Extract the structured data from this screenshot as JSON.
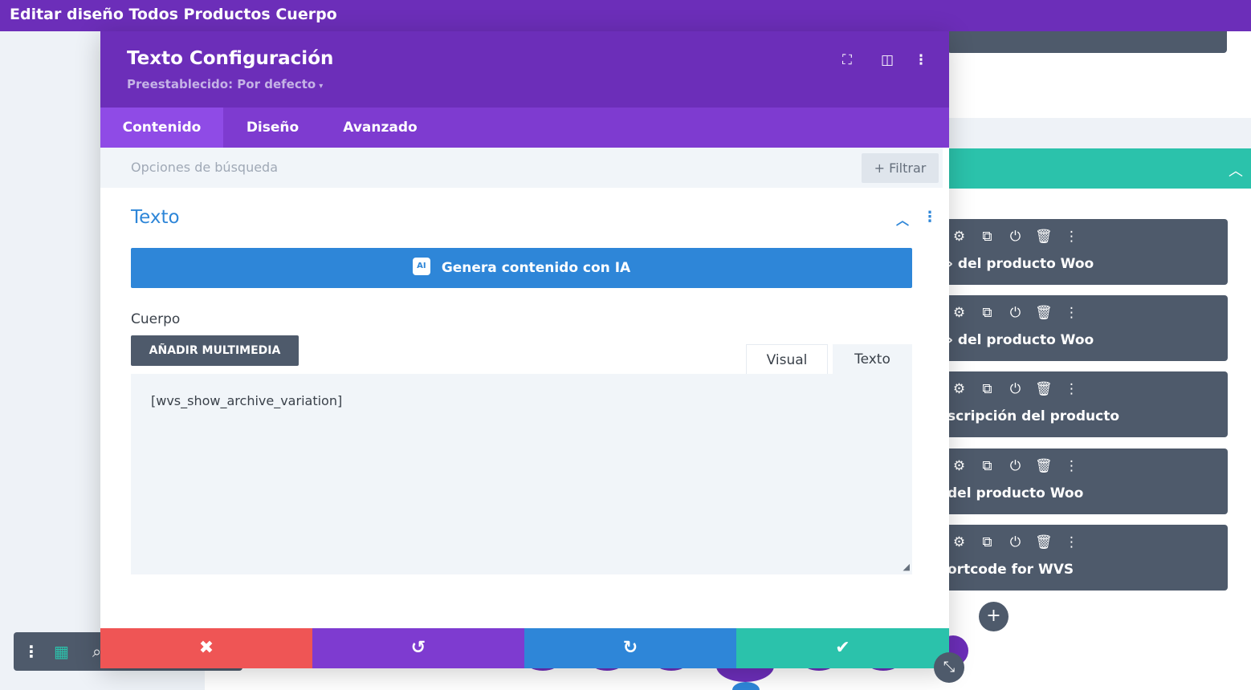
{
  "topbar": {
    "title": "Editar diseño Todos Productos Cuerpo"
  },
  "modal": {
    "title": "Texto Configuración",
    "preset": "Preestablecido: Por defecto",
    "header_icons": [
      "focus-icon",
      "split-view-icon",
      "more-vertical-icon"
    ],
    "tabs": [
      {
        "label": "Contenido",
        "active": true
      },
      {
        "label": "Diseño",
        "active": false
      },
      {
        "label": "Avanzado",
        "active": false
      }
    ],
    "search": {
      "placeholder": "Opciones de búsqueda",
      "filter_label": "Filtrar"
    },
    "section": {
      "title": "Texto"
    },
    "ai_button": {
      "badge": "AI",
      "label": "Genera contenido con IA"
    },
    "body": {
      "label": "Cuerpo",
      "add_media": "AÑADIR MULTIMEDIA",
      "editor_tabs": [
        "Visual",
        "Texto"
      ],
      "content": "[wvs_show_archive_variation]"
    }
  },
  "modules": [
    {
      "title": "› del producto Woo"
    },
    {
      "title": "› del producto Woo"
    },
    {
      "title": "scripción del producto"
    },
    {
      "title": " del producto Woo"
    },
    {
      "title": "ortcode for WVS"
    }
  ],
  "colors": {
    "purple": "#6c2eb9",
    "tab_purple": "#7e3bd0",
    "blue": "#2e86d8",
    "teal": "#2bc2ab",
    "red": "#ef5555",
    "dark_gray": "#4e5a6b"
  }
}
